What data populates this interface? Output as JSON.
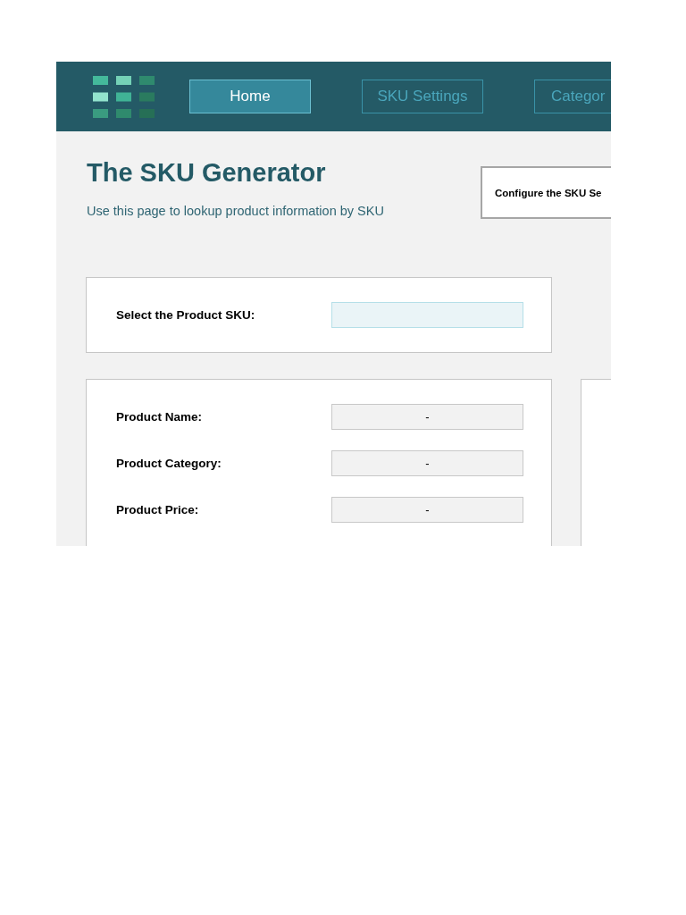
{
  "header": {
    "tabs": [
      {
        "label": "Home",
        "selected": true
      },
      {
        "label": "SKU Settings",
        "selected": false
      },
      {
        "label": "Categor",
        "selected": false
      }
    ]
  },
  "intro": {
    "title": "The SKU Generator",
    "subtitle": "Use this page to lookup product information by SKU",
    "config_button": "Configure the SKU Se"
  },
  "lookup": {
    "label": "Select the Product SKU:"
  },
  "details": {
    "rows": [
      {
        "label": "Product Name:",
        "value": "-"
      },
      {
        "label": "Product Category:",
        "value": "-"
      },
      {
        "label": "Product Price:",
        "value": "-"
      }
    ]
  }
}
